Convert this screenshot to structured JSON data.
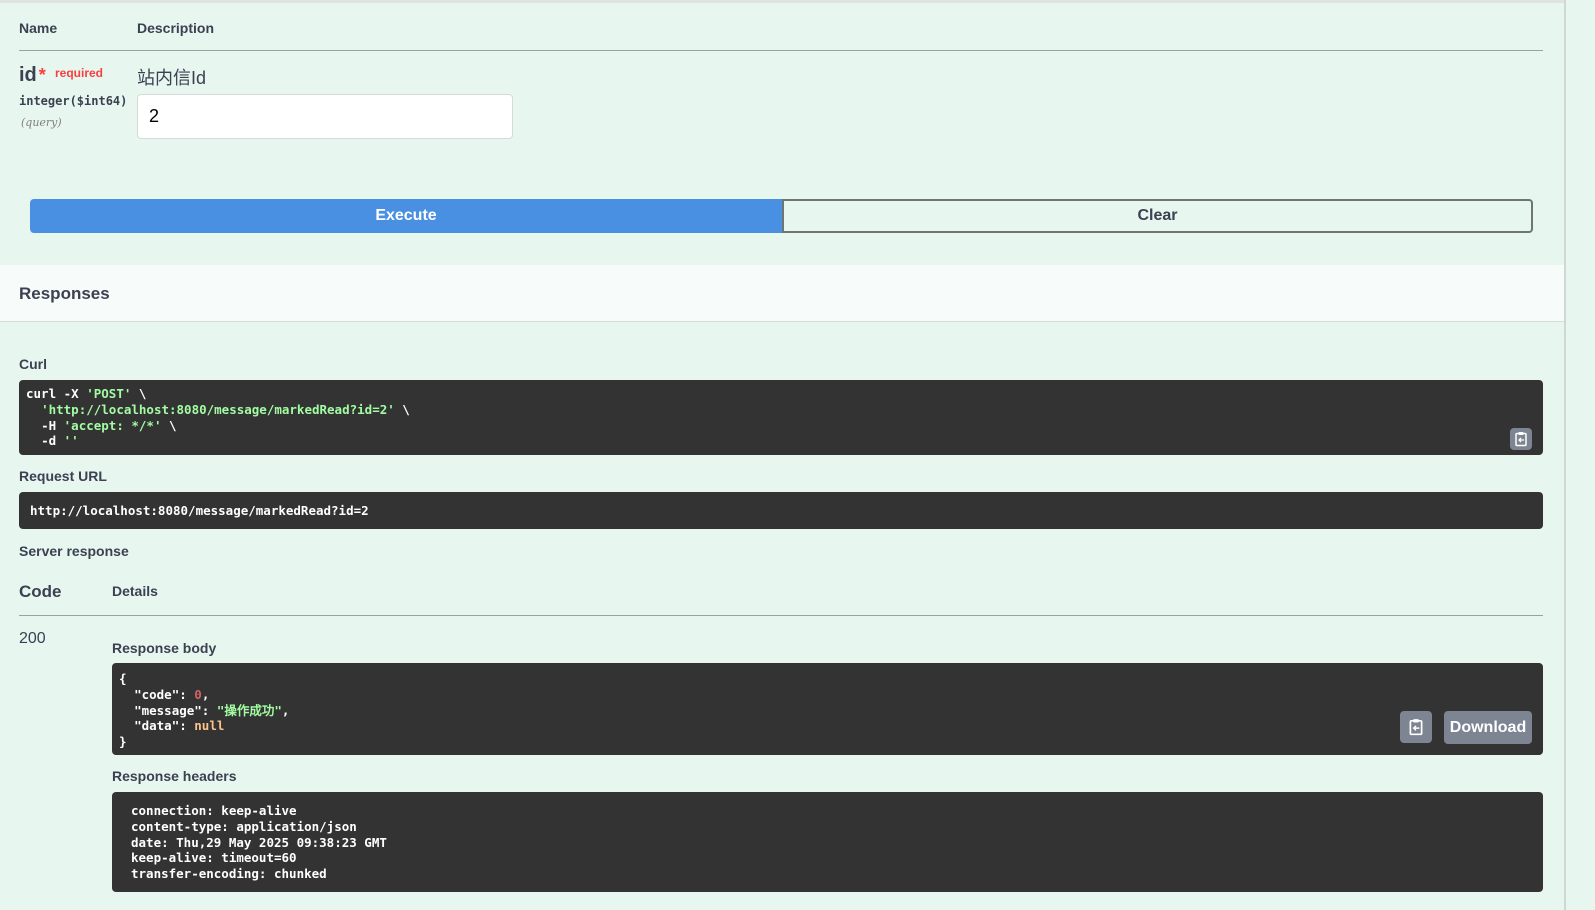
{
  "params": {
    "col_name": "Name",
    "col_description": "Description",
    "items": [
      {
        "name": "id",
        "required_marker": "*",
        "required_text": "required",
        "type": "integer($int64)",
        "location": "(query)",
        "description": "站内信Id",
        "value": "2"
      }
    ]
  },
  "buttons": {
    "execute": "Execute",
    "clear": "Clear"
  },
  "responses": {
    "title": "Responses",
    "curl_label": "Curl",
    "curl": {
      "line1_cmd": "curl -X ",
      "line1_method": "'POST'",
      "line1_tail": " \\",
      "line2_url": "'http://localhost:8080/message/markedRead?id=2'",
      "line2_tail": " \\",
      "line3_flag": "-H ",
      "line3_header": "'accept: */*'",
      "line3_tail": " \\",
      "line4_flag": "-d ",
      "line4_data": "''"
    },
    "request_url_label": "Request URL",
    "request_url": "http://localhost:8080/message/markedRead?id=2",
    "server_response_label": "Server response",
    "col_code": "Code",
    "col_details": "Details",
    "status_code": "200",
    "body_label": "Response body",
    "body": {
      "open": "{",
      "code_key": "\"code\"",
      "code_val": "0",
      "message_key": "\"message\"",
      "message_val": "\"操作成功\"",
      "data_key": "\"data\"",
      "data_val": "null",
      "close": "}"
    },
    "download_label": "Download",
    "headers_label": "Response headers",
    "headers": [
      "connection: keep-alive",
      "content-type: application/json",
      "date: Thu,29 May 2025 09:38:23 GMT",
      "keep-alive: timeout=60",
      "transfer-encoding: chunked"
    ]
  },
  "icons": {
    "copy": "clipboard-copy-icon"
  },
  "colors": {
    "background": "#e8f6f0",
    "execute": "#4990e2",
    "required": "#f93e3e",
    "code_bg": "#333333",
    "string": "#a2fca2",
    "number": "#d36363",
    "null": "#fcc28c"
  }
}
